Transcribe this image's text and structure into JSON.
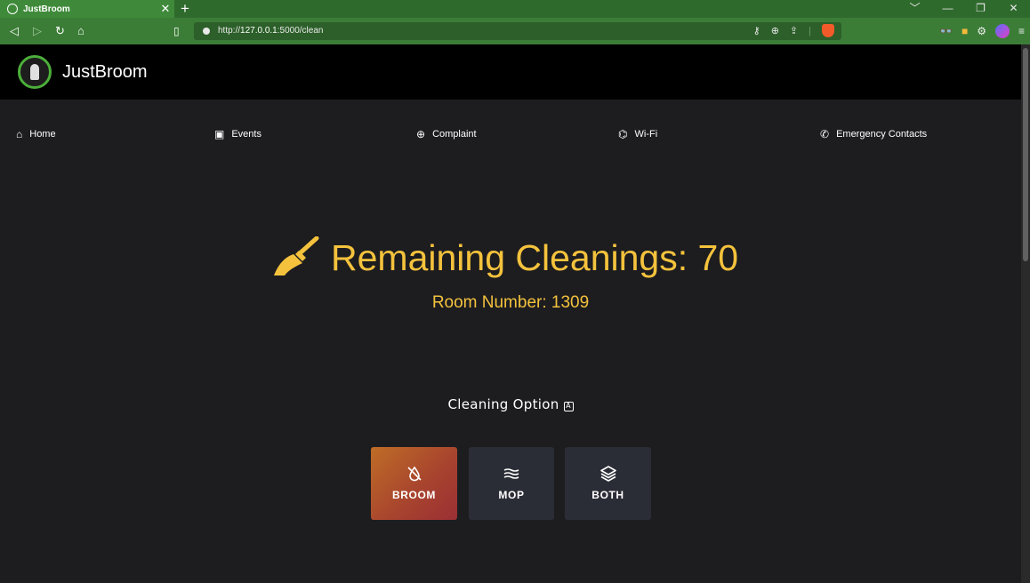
{
  "browser": {
    "tab_title": "JustBroom",
    "tab_close": "✕",
    "new_tab": "+",
    "url_prefix": "http://",
    "url_host": "127.0.0.1",
    "url_path": ":5000/clean",
    "window_controls": [
      "﹀",
      "—",
      "❐",
      "✕"
    ]
  },
  "header": {
    "brand": "JustBroom"
  },
  "nav": {
    "items": [
      {
        "label": "Home",
        "icon": "home-icon",
        "glyph": "⌂"
      },
      {
        "label": "Events",
        "icon": "events-icon",
        "glyph": "▣"
      },
      {
        "label": "Complaint",
        "icon": "complaint-icon",
        "glyph": "⊕"
      },
      {
        "label": "Wi-Fi",
        "icon": "wifi-icon",
        "glyph": "⌬"
      },
      {
        "label": "Emergency Contacts",
        "icon": "phone-icon",
        "glyph": "✆"
      }
    ]
  },
  "main": {
    "remaining_label": "Remaining Cleanings: 70",
    "room_label": "Room Number: 1309",
    "option_title": "Cleaning Option",
    "options": [
      {
        "label": "BROOM",
        "icon": "no-drop-icon",
        "selected": true
      },
      {
        "label": "MOP",
        "icon": "waves-icon",
        "selected": false
      },
      {
        "label": "BOTH",
        "icon": "layers-icon",
        "selected": false
      }
    ]
  },
  "colors": {
    "accent": "#f4c23c",
    "header_bg": "#000000",
    "page_bg": "#1d1d20",
    "option_bg": "#2b2d36",
    "selected_gradient_start": "#bf6d27",
    "selected_gradient_end": "#9b2f34",
    "browser_green": "#3b7d37"
  }
}
